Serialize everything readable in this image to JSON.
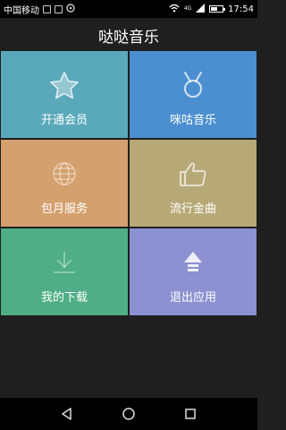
{
  "status_bar": {
    "carrier": "中国移动",
    "network": "4G",
    "time": "17:54",
    "battery_level": 0.6,
    "icons": [
      "message-icon",
      "image-icon",
      "settings-icon",
      "wifi-icon",
      "signal-icon",
      "battery-icon"
    ]
  },
  "app": {
    "title": "哒哒音乐"
  },
  "tiles": [
    {
      "label": "开通会员",
      "icon": "star-icon",
      "color": "#5aa9ba"
    },
    {
      "label": "咪咕音乐",
      "icon": "medal-icon",
      "color": "#4c8fd0"
    },
    {
      "label": "包月服务",
      "icon": "globe-icon",
      "color": "#d4a06e"
    },
    {
      "label": "流行金曲",
      "icon": "thumbs-up-icon",
      "color": "#b7a977"
    },
    {
      "label": "我的下载",
      "icon": "download-icon",
      "color": "#4fae86"
    },
    {
      "label": "退出应用",
      "icon": "exit-arrow-icon",
      "color": "#8c91d2"
    }
  ],
  "nav_bar": {
    "icons": [
      "back-icon",
      "home-icon",
      "recents-icon"
    ]
  }
}
